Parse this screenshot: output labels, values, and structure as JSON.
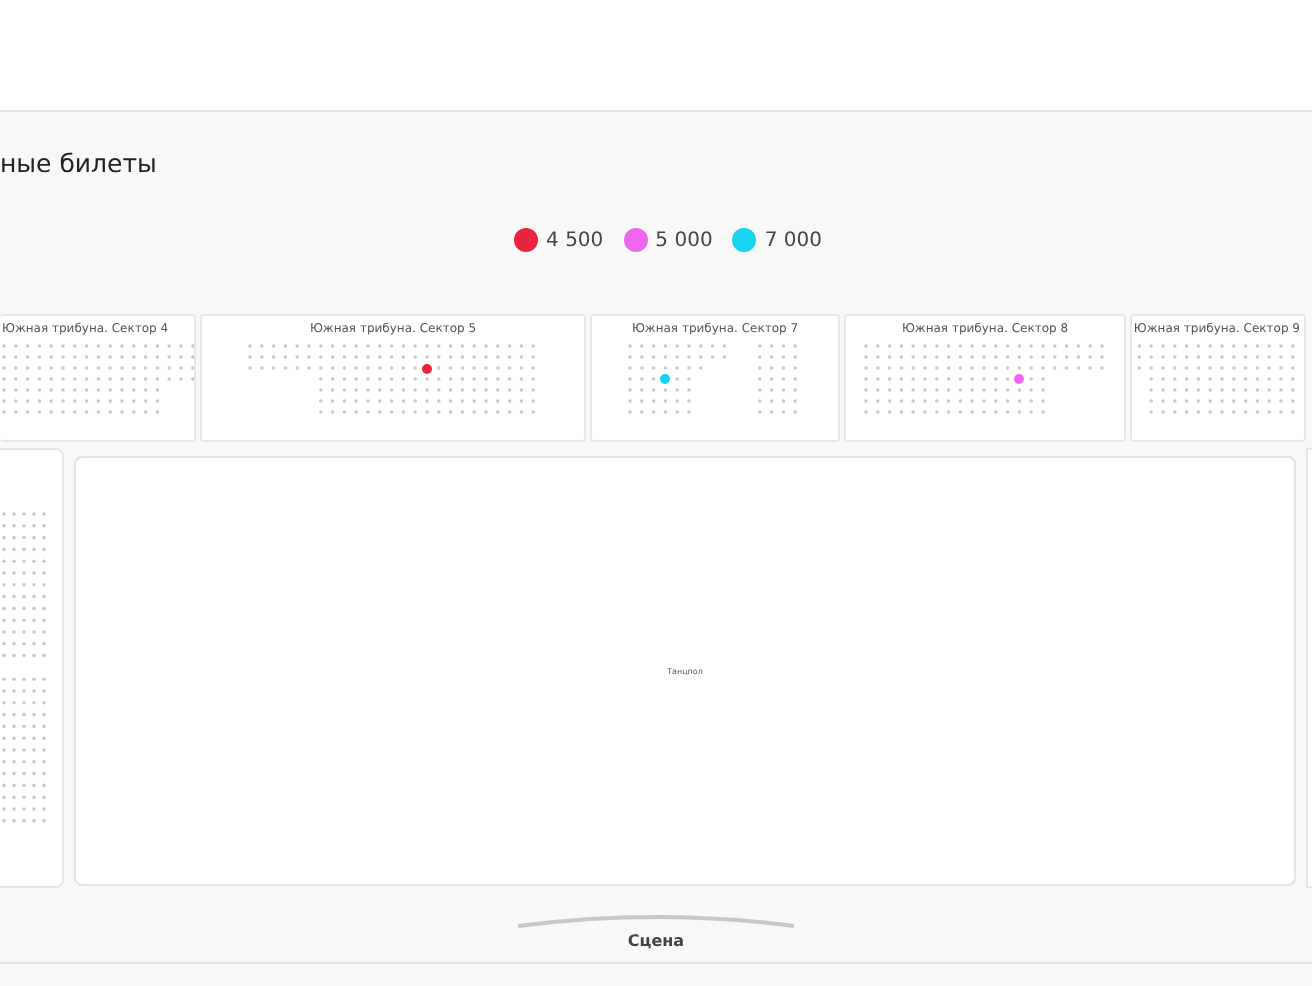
{
  "title": "ные билеты",
  "legend": [
    {
      "price": "4 500",
      "color": "#e8253f"
    },
    {
      "price": "5 000",
      "color": "#ee66ee"
    },
    {
      "price": "7 000",
      "color": "#17d3ef"
    }
  ],
  "sectors": [
    {
      "label": "Южная трибуна. Сектор 4"
    },
    {
      "label": "Южная трибуна. Сектор 5",
      "color": "#e8253f"
    },
    {
      "label": "Южная трибуна. Сектор 7",
      "color": "#17d3ef"
    },
    {
      "label": "Южная трибуна. Сектор 8",
      "color": "#ee66ee"
    },
    {
      "label": "Южная трибуна. Сектор 9"
    }
  ],
  "dance_floor": {
    "label": "Танцпол"
  },
  "stage": {
    "label": "Сцена"
  }
}
